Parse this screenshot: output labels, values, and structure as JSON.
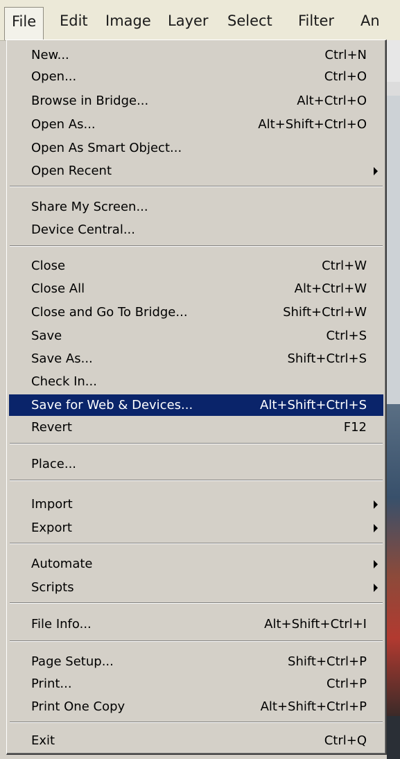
{
  "menubar": {
    "items": [
      "File",
      "Edit",
      "Image",
      "Layer",
      "Select",
      "Filter",
      "An"
    ]
  },
  "file_menu": {
    "items": [
      {
        "label": "New...",
        "shortcut": "Ctrl+N"
      },
      {
        "label": "Open...",
        "shortcut": "Ctrl+O"
      },
      {
        "label": "Browse in Bridge...",
        "shortcut": "Alt+Ctrl+O"
      },
      {
        "label": "Open As...",
        "shortcut": "Alt+Shift+Ctrl+O"
      },
      {
        "label": "Open As Smart Object...",
        "shortcut": ""
      },
      {
        "label": "Open Recent",
        "shortcut": "",
        "submenu": true
      },
      {
        "label": "Share My Screen...",
        "shortcut": ""
      },
      {
        "label": "Device Central...",
        "shortcut": ""
      },
      {
        "label": "Close",
        "shortcut": "Ctrl+W"
      },
      {
        "label": "Close All",
        "shortcut": "Alt+Ctrl+W"
      },
      {
        "label": "Close and Go To Bridge...",
        "shortcut": "Shift+Ctrl+W"
      },
      {
        "label": "Save",
        "shortcut": "Ctrl+S"
      },
      {
        "label": "Save As...",
        "shortcut": "Shift+Ctrl+S"
      },
      {
        "label": "Check In...",
        "shortcut": ""
      },
      {
        "label": "Save for Web & Devices...",
        "shortcut": "Alt+Shift+Ctrl+S",
        "highlighted": true
      },
      {
        "label": "Revert",
        "shortcut": "F12"
      },
      {
        "label": "Place...",
        "shortcut": ""
      },
      {
        "label": "Import",
        "shortcut": "",
        "submenu": true
      },
      {
        "label": "Export",
        "shortcut": "",
        "submenu": true
      },
      {
        "label": "Automate",
        "shortcut": "",
        "submenu": true
      },
      {
        "label": "Scripts",
        "shortcut": "",
        "submenu": true
      },
      {
        "label": "File Info...",
        "shortcut": "Alt+Shift+Ctrl+I"
      },
      {
        "label": "Page Setup...",
        "shortcut": "Shift+Ctrl+P"
      },
      {
        "label": "Print...",
        "shortcut": "Ctrl+P"
      },
      {
        "label": "Print One Copy",
        "shortcut": "Alt+Shift+Ctrl+P"
      },
      {
        "label": "Exit",
        "shortcut": "Ctrl+Q"
      }
    ]
  },
  "colors": {
    "menu_background": "#d4d0c8",
    "highlight": "#0a246a",
    "highlight_text": "#ffffff"
  },
  "icons": {
    "submenu_arrow": "submenu-arrow-icon"
  }
}
